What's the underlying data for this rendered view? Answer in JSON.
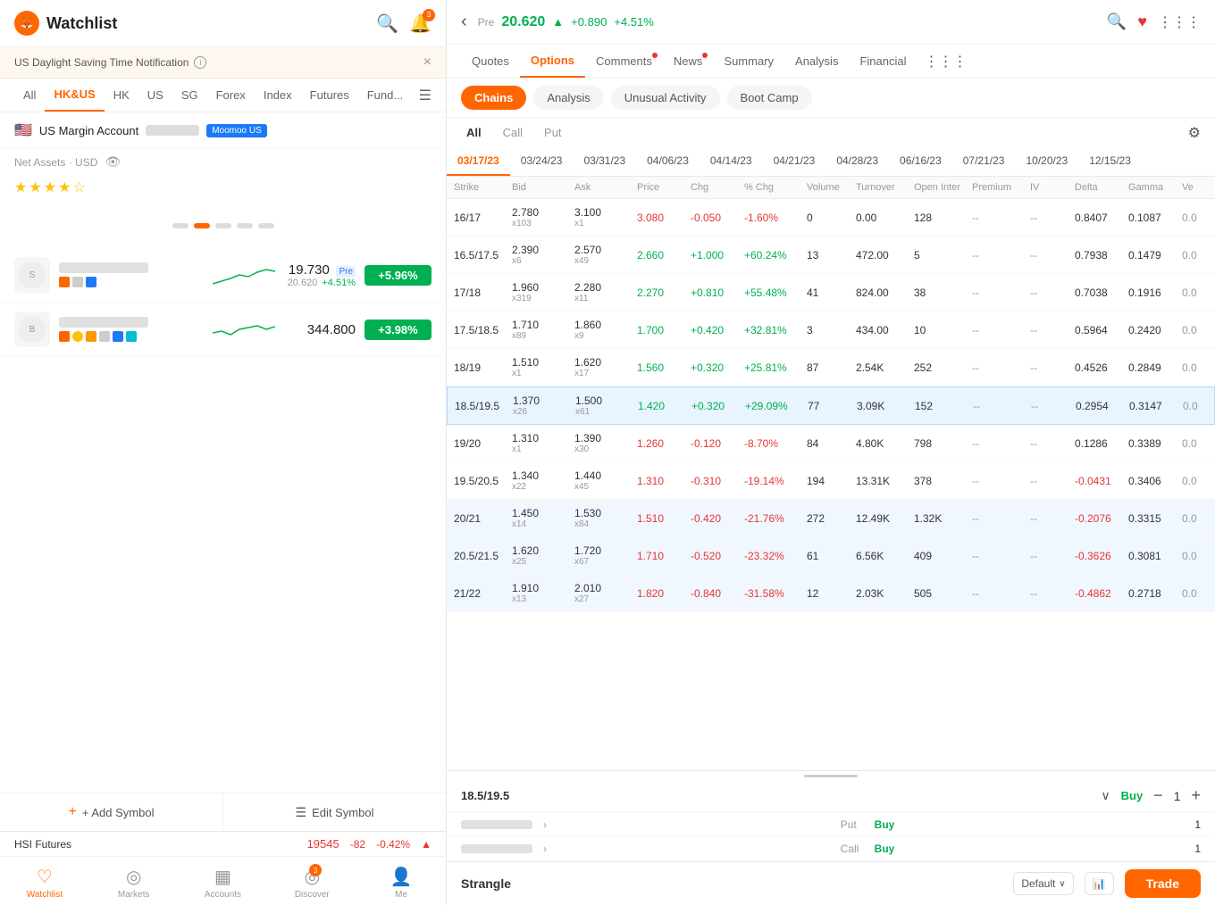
{
  "left": {
    "title": "Watchlist",
    "notification": {
      "text": "US Daylight Saving Time Notification",
      "close": "×"
    },
    "market_tabs": [
      {
        "label": "All",
        "active": false
      },
      {
        "label": "HK&US",
        "active": true
      },
      {
        "label": "HK",
        "active": false
      },
      {
        "label": "US",
        "active": false
      },
      {
        "label": "SG",
        "active": false
      },
      {
        "label": "Forex",
        "active": false
      },
      {
        "label": "Index",
        "active": false
      },
      {
        "label": "Futures",
        "active": false
      },
      {
        "label": "Fund...",
        "active": false
      }
    ],
    "account": {
      "name": "US Margin Account",
      "badge": "Moomoo US"
    },
    "net_assets_label": "Net Assets · USD",
    "stocks": [
      {
        "price": "19.730",
        "sub_price": "20.620",
        "sub_price2": "+4.51%",
        "change": "+5.96%",
        "change_type": "green",
        "has_pre": true
      },
      {
        "price": "344.800",
        "sub_price": "",
        "sub_price2": "",
        "change": "+3.98%",
        "change_type": "green",
        "has_pre": false
      }
    ],
    "actions": {
      "add_symbol": "+ Add Symbol",
      "edit_symbol": "Edit Symbol"
    },
    "hsi": {
      "label": "HSI Futures",
      "price": "19545",
      "change": "-82",
      "pct": "-0.42%"
    },
    "nav_tabs": [
      {
        "label": "Watchlist",
        "active": true,
        "icon": "♡"
      },
      {
        "label": "Markets",
        "active": false,
        "icon": "◎"
      },
      {
        "label": "Accounts",
        "active": false,
        "icon": "▦"
      },
      {
        "label": "Discover",
        "active": false,
        "icon": "◉",
        "badge": "3"
      },
      {
        "label": "Me",
        "active": false,
        "icon": "👤"
      }
    ]
  },
  "right": {
    "header": {
      "pre_label": "Pre",
      "price": "20.620",
      "change": "+0.890",
      "pct": "+4.51%"
    },
    "main_tabs": [
      {
        "label": "Quotes",
        "active": false,
        "dot": false
      },
      {
        "label": "Options",
        "active": true,
        "dot": false
      },
      {
        "label": "Comments",
        "active": false,
        "dot": true
      },
      {
        "label": "News",
        "active": false,
        "dot": true
      },
      {
        "label": "Summary",
        "active": false,
        "dot": false
      },
      {
        "label": "Analysis",
        "active": false,
        "dot": false
      },
      {
        "label": "Financial",
        "active": false,
        "dot": false
      }
    ],
    "sub_tabs": [
      {
        "label": "Chains",
        "active": true
      },
      {
        "label": "Analysis",
        "active": false
      },
      {
        "label": "Unusual Activity",
        "active": false
      },
      {
        "label": "Boot Camp",
        "active": false
      }
    ],
    "call_put_tabs": [
      {
        "label": "All",
        "active": true
      },
      {
        "label": "Call",
        "active": false
      },
      {
        "label": "Put",
        "active": false
      }
    ],
    "dates": [
      {
        "label": "03/17/23",
        "active": true
      },
      {
        "label": "03/24/23",
        "active": false
      },
      {
        "label": "03/31/23",
        "active": false
      },
      {
        "label": "04/06/23",
        "active": false
      },
      {
        "label": "04/14/23",
        "active": false
      },
      {
        "label": "04/21/23",
        "active": false
      },
      {
        "label": "04/28/23",
        "active": false
      },
      {
        "label": "06/16/23",
        "active": false
      },
      {
        "label": "07/21/23",
        "active": false
      },
      {
        "label": "10/20/23",
        "active": false
      },
      {
        "label": "12/15/23",
        "active": false
      }
    ],
    "table_headers": [
      "Strike",
      "Bid",
      "Ask",
      "Price",
      "Chg",
      "% Chg",
      "Volume",
      "Turnover",
      "Open Inter",
      "Premium",
      "IV",
      "Delta",
      "Gamma",
      "Ve"
    ],
    "rows": [
      {
        "strike": "16/17",
        "bid": "2.780",
        "bid_x": "x103",
        "ask": "3.100",
        "ask_x": "x1",
        "price": "3.080",
        "price_type": "red",
        "chg": "-0.050",
        "chg_type": "red",
        "pct": "-1.60%",
        "pct_type": "red",
        "vol": "0",
        "turnover": "0.00",
        "oi": "128",
        "premium": "--",
        "iv": "--",
        "delta": "0.8407",
        "gamma": "0.1087",
        "ve": "0.0",
        "highlighted": false,
        "blue_bg": false
      },
      {
        "strike": "16.5/17.5",
        "bid": "2.390",
        "bid_x": "x6",
        "ask": "2.570",
        "ask_x": "x49",
        "price": "2.660",
        "price_type": "green",
        "chg": "+1.000",
        "chg_type": "green",
        "pct": "+60.24%",
        "pct_type": "green",
        "vol": "13",
        "turnover": "472.00",
        "oi": "5",
        "premium": "--",
        "iv": "--",
        "delta": "0.7938",
        "gamma": "0.1479",
        "ve": "0.0",
        "highlighted": false,
        "blue_bg": false
      },
      {
        "strike": "17/18",
        "bid": "1.960",
        "bid_x": "x319",
        "ask": "2.280",
        "ask_x": "x11",
        "price": "2.270",
        "price_type": "green",
        "chg": "+0.810",
        "chg_type": "green",
        "pct": "+55.48%",
        "pct_type": "green",
        "vol": "41",
        "turnover": "824.00",
        "oi": "38",
        "premium": "--",
        "iv": "--",
        "delta": "0.7038",
        "gamma": "0.1916",
        "ve": "0.0",
        "highlighted": false,
        "blue_bg": false
      },
      {
        "strike": "17.5/18.5",
        "bid": "1.710",
        "bid_x": "x89",
        "ask": "1.860",
        "ask_x": "x9",
        "price": "1.700",
        "price_type": "green",
        "chg": "+0.420",
        "chg_type": "green",
        "pct": "+32.81%",
        "pct_type": "green",
        "vol": "3",
        "turnover": "434.00",
        "oi": "10",
        "premium": "--",
        "iv": "--",
        "delta": "0.5964",
        "gamma": "0.2420",
        "ve": "0.0",
        "highlighted": false,
        "blue_bg": false
      },
      {
        "strike": "18/19",
        "bid": "1.510",
        "bid_x": "x1",
        "ask": "1.620",
        "ask_x": "x17",
        "price": "1.560",
        "price_type": "green",
        "chg": "+0.320",
        "chg_type": "green",
        "pct": "+25.81%",
        "pct_type": "green",
        "vol": "87",
        "turnover": "2.54K",
        "oi": "252",
        "premium": "--",
        "iv": "--",
        "delta": "0.4526",
        "gamma": "0.2849",
        "ve": "0.0",
        "highlighted": false,
        "blue_bg": false
      },
      {
        "strike": "18.5/19.5",
        "bid": "1.370",
        "bid_x": "x26",
        "ask": "1.500",
        "ask_x": "x61",
        "price": "1.420",
        "price_type": "green",
        "chg": "+0.320",
        "chg_type": "green",
        "pct": "+29.09%",
        "pct_type": "green",
        "vol": "77",
        "turnover": "3.09K",
        "oi": "152",
        "premium": "--",
        "iv": "--",
        "delta": "0.2954",
        "gamma": "0.3147",
        "ve": "0.0",
        "highlighted": true,
        "blue_bg": false
      },
      {
        "strike": "19/20",
        "bid": "1.310",
        "bid_x": "x1",
        "ask": "1.390",
        "ask_x": "x30",
        "price": "1.260",
        "price_type": "red",
        "chg": "-0.120",
        "chg_type": "red",
        "pct": "-8.70%",
        "pct_type": "red",
        "vol": "84",
        "turnover": "4.80K",
        "oi": "798",
        "premium": "--",
        "iv": "--",
        "delta": "0.1286",
        "gamma": "0.3389",
        "ve": "0.0",
        "highlighted": false,
        "blue_bg": false
      },
      {
        "strike": "19.5/20.5",
        "bid": "1.340",
        "bid_x": "x22",
        "ask": "1.440",
        "ask_x": "x45",
        "price": "1.310",
        "price_type": "red",
        "chg": "-0.310",
        "chg_type": "red",
        "pct": "-19.14%",
        "pct_type": "red",
        "vol": "194",
        "turnover": "13.31K",
        "oi": "378",
        "premium": "--",
        "iv": "--",
        "delta": "-0.0431",
        "gamma": "0.3406",
        "ve": "0.0",
        "highlighted": false,
        "blue_bg": false
      },
      {
        "strike": "20/21",
        "bid": "1.450",
        "bid_x": "x14",
        "ask": "1.530",
        "ask_x": "x84",
        "price": "1.510",
        "price_type": "red",
        "chg": "-0.420",
        "chg_type": "red",
        "pct": "-21.76%",
        "pct_type": "red",
        "vol": "272",
        "turnover": "12.49K",
        "oi": "1.32K",
        "premium": "--",
        "iv": "--",
        "delta": "-0.2076",
        "gamma": "0.3315",
        "ve": "0.0",
        "highlighted": false,
        "blue_bg": true
      },
      {
        "strike": "20.5/21.5",
        "bid": "1.620",
        "bid_x": "x25",
        "ask": "1.720",
        "ask_x": "x67",
        "price": "1.710",
        "price_type": "red",
        "chg": "-0.520",
        "chg_type": "red",
        "pct": "-23.32%",
        "pct_type": "red",
        "vol": "61",
        "turnover": "6.56K",
        "oi": "409",
        "premium": "--",
        "iv": "--",
        "delta": "-0.3626",
        "gamma": "0.3081",
        "ve": "0.0",
        "highlighted": false,
        "blue_bg": true
      },
      {
        "strike": "21/22",
        "bid": "1.910",
        "bid_x": "x13",
        "ask": "2.010",
        "ask_x": "x27",
        "price": "1.820",
        "price_type": "red",
        "chg": "-0.840",
        "chg_type": "red",
        "pct": "-31.58%",
        "pct_type": "red",
        "vol": "12",
        "turnover": "2.03K",
        "oi": "505",
        "premium": "--",
        "iv": "--",
        "delta": "-0.4862",
        "gamma": "0.2718",
        "ve": "0.0",
        "highlighted": false,
        "blue_bg": true
      }
    ],
    "order": {
      "symbol": "18.5/19.5",
      "action": "Buy",
      "qty": "1",
      "options": [
        {
          "type": "Put",
          "action": "Buy",
          "qty": "1"
        },
        {
          "type": "Call",
          "action": "Buy",
          "qty": "1"
        }
      ]
    },
    "bottom": {
      "strangle": "Strangle",
      "default": "Default",
      "trade": "Trade"
    }
  }
}
